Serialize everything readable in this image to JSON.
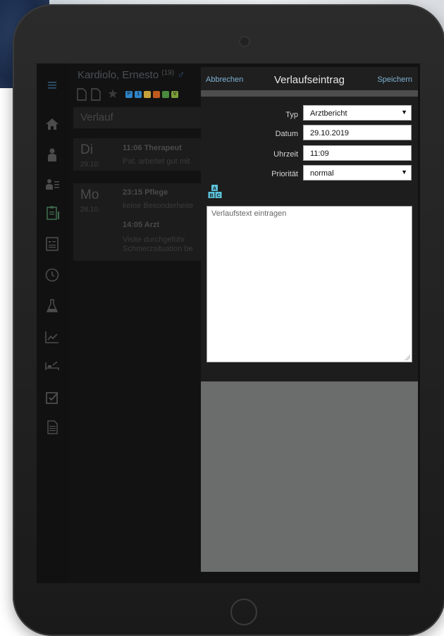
{
  "patient": {
    "name": "Kardiolo, Ernesto",
    "age": "(19)",
    "sex_symbol": "♂"
  },
  "chips": [
    {
      "label": "P",
      "color": "#2e84c6"
    },
    {
      "label": "1",
      "color": "#2e84c6"
    },
    {
      "label": "",
      "color": "#c8a23a"
    },
    {
      "label": "",
      "color": "#c05a1f"
    },
    {
      "label": "",
      "color": "#4a8a3f"
    },
    {
      "label": "V",
      "color": "#7b9e3a"
    }
  ],
  "section": {
    "title": "Verlauf"
  },
  "days": [
    {
      "dow": "Di",
      "date": "29.10.",
      "entries": [
        {
          "head": "11:06  Therapeut",
          "text": "Pat. arbeitet gut mit"
        }
      ]
    },
    {
      "dow": "Mo",
      "date": "28.10.",
      "entries": [
        {
          "head": "23:15  Pflege",
          "text": "keine Besonderheite"
        },
        {
          "head": "14:05  Arzt",
          "text": "Visite  durchgeführ Schmerzsituation be"
        }
      ]
    }
  ],
  "modal": {
    "cancel_label": "Abbrechen",
    "title": "Verlaufseintrag",
    "save_label": "Speichern",
    "form": {
      "type_label": "Typ",
      "type_value": "Arztbericht",
      "date_label": "Datum",
      "date_value": "29.10.2019",
      "time_label": "Uhrzeit",
      "time_value": "11:09",
      "priority_label": "Priorität",
      "priority_value": "normal"
    },
    "text_placeholder": "Verlaufstext eintragen"
  },
  "icons": {
    "sidebar": [
      "menu-icon",
      "home-icon",
      "person-icon",
      "person-list-icon",
      "clipboard-icon",
      "id-card-icon",
      "clock-icon",
      "flask-icon",
      "chart-icon",
      "bed-icon",
      "checkbox-icon",
      "document-icon"
    ],
    "abc": "abc-blocks-icon"
  }
}
